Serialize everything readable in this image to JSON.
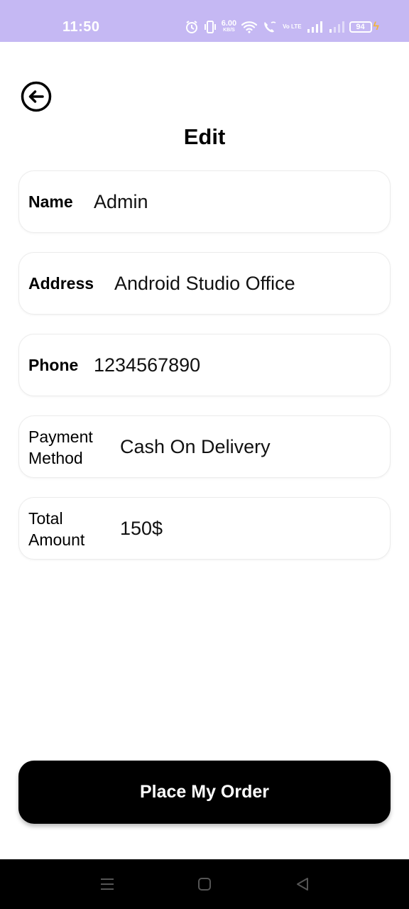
{
  "status_bar": {
    "time": "11:50",
    "net_speed_value": "6.00",
    "net_speed_unit": "KB/S",
    "lte_label": "Vo LTE",
    "battery": "94",
    "icons": [
      "alarm-icon",
      "vibrate-icon",
      "wifi-icon",
      "wifi-calling-icon",
      "signal-icon",
      "battery-icon",
      "charging-icon"
    ]
  },
  "header": {
    "back_icon": "arrow-left-circle-icon",
    "title": "Edit"
  },
  "form": {
    "fields": [
      {
        "label": "Name",
        "value": "Admin"
      },
      {
        "label": "Address",
        "value": "Android Studio Office"
      },
      {
        "label": "Phone",
        "value": "1234567890"
      },
      {
        "label_line1": "Payment",
        "label_line2": "Method",
        "value": "Cash On Delivery"
      },
      {
        "label_line1": "Total",
        "label_line2": "Amount",
        "value": "150$"
      }
    ]
  },
  "footer": {
    "place_order_label": "Place My Order"
  },
  "nav_bar": {
    "icons": [
      "menu-icon",
      "home-icon",
      "back-triangle-icon"
    ]
  },
  "colors": {
    "status_bar_bg": "#c5b8f3",
    "button_bg": "#000000",
    "button_text": "#ffffff",
    "charging": "#f2b43a"
  }
}
